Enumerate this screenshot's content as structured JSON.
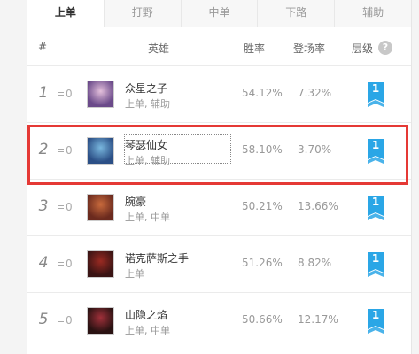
{
  "tabs": [
    {
      "label": "上单"
    },
    {
      "label": "打野"
    },
    {
      "label": "中单"
    },
    {
      "label": "下路"
    },
    {
      "label": "辅助"
    }
  ],
  "active_tab": 0,
  "columns": {
    "rank": "#",
    "hero": "英雄",
    "win_rate": "胜率",
    "pick_rate": "登场率",
    "tier": "层级",
    "tier_help": "?"
  },
  "rows": [
    {
      "rank": "1",
      "delta": "0",
      "name": "众星之子",
      "roles": "上单, 辅助",
      "win_rate": "54.12%",
      "pick_rate": "7.32%",
      "tier": "1",
      "avatar_colors": [
        "#6b4a8a",
        "#e4c0dc"
      ]
    },
    {
      "rank": "2",
      "delta": "0",
      "name": "琴瑟仙女",
      "roles": "上单, 辅助",
      "win_rate": "58.10%",
      "pick_rate": "3.70%",
      "tier": "1",
      "avatar_colors": [
        "#2b4f86",
        "#79b7de"
      ]
    },
    {
      "rank": "3",
      "delta": "0",
      "name": "腕豪",
      "roles": "上单, 中单",
      "win_rate": "50.21%",
      "pick_rate": "13.66%",
      "tier": "1",
      "avatar_colors": [
        "#6b2a1e",
        "#c86a3c"
      ]
    },
    {
      "rank": "4",
      "delta": "0",
      "name": "诺克萨斯之手",
      "roles": "上单",
      "win_rate": "51.26%",
      "pick_rate": "8.82%",
      "tier": "1",
      "avatar_colors": [
        "#3a1414",
        "#9a2a22"
      ]
    },
    {
      "rank": "5",
      "delta": "0",
      "name": "山隐之焰",
      "roles": "上单, 中单",
      "win_rate": "50.66%",
      "pick_rate": "12.17%",
      "tier": "1",
      "avatar_colors": [
        "#2a1212",
        "#a0303a"
      ]
    }
  ],
  "colors": {
    "tier_badge": "#2aa6e6",
    "highlight": "#e53935"
  }
}
